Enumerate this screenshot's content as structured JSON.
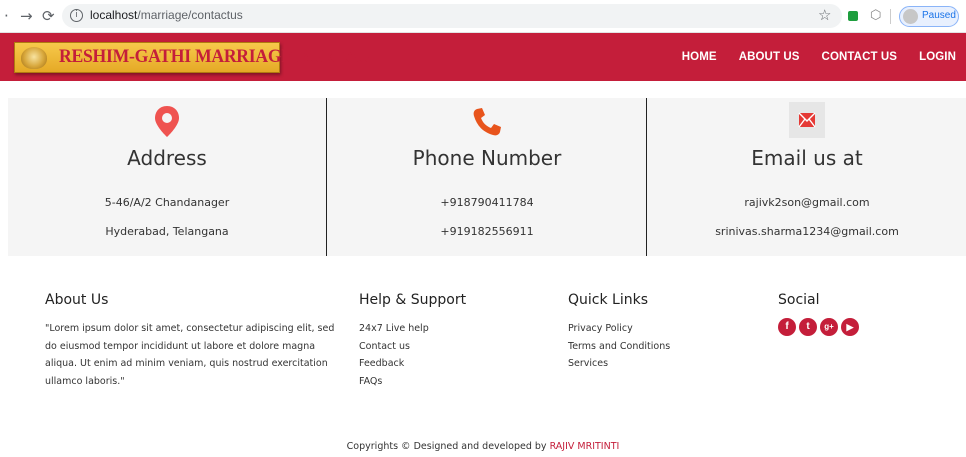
{
  "browser": {
    "back_icon": "arrow-left-icon",
    "forward_icon": "arrow-right-icon",
    "reload_icon": "reload-icon",
    "url_host": "localhost",
    "url_path": "/marriage/contactus",
    "profile_status": "Paused"
  },
  "site": {
    "brand_color": "#c41e3a",
    "logo_text": "RESHIM-GATHI MARRIAGE BUREAU",
    "nav": [
      "HOME",
      "ABOUT US",
      "CONTACT US",
      "LOGIN"
    ]
  },
  "contact": {
    "address": {
      "icon": "map-pin-icon",
      "title": "Address",
      "line1": "5-46/A/2 Chandanager",
      "line2": "Hyderabad, Telangana"
    },
    "phone": {
      "icon": "phone-icon",
      "title": "Phone Number",
      "line1": "+918790411784",
      "line2": "+919182556911"
    },
    "email": {
      "icon": "envelope-icon",
      "title": "Email us at",
      "line1": "rajivk2son@gmail.com",
      "line2": "srinivas.sharma1234@gmail.com"
    }
  },
  "footer": {
    "about": {
      "title": "About Us",
      "text": "\"Lorem ipsum dolor sit amet, consectetur adipiscing elit, sed do eiusmod tempor incididunt ut labore et dolore magna aliqua. Ut enim ad minim veniam, quis nostrud exercitation ullamco laboris.\""
    },
    "help": {
      "title": "Help & Support",
      "links": [
        "24x7 Live help",
        "Contact us",
        "Feedback",
        "FAQs"
      ]
    },
    "quick": {
      "title": "Quick Links",
      "links": [
        "Privacy Policy",
        "Terms and Conditions",
        "Services"
      ]
    },
    "social": {
      "title": "Social",
      "icons": [
        "facebook-icon",
        "twitter-icon",
        "google-plus-icon",
        "youtube-icon"
      ]
    },
    "copyright_prefix": "Copyrights © Designed and developed by ",
    "copyright_author": "RAJIV MRITINTI"
  }
}
